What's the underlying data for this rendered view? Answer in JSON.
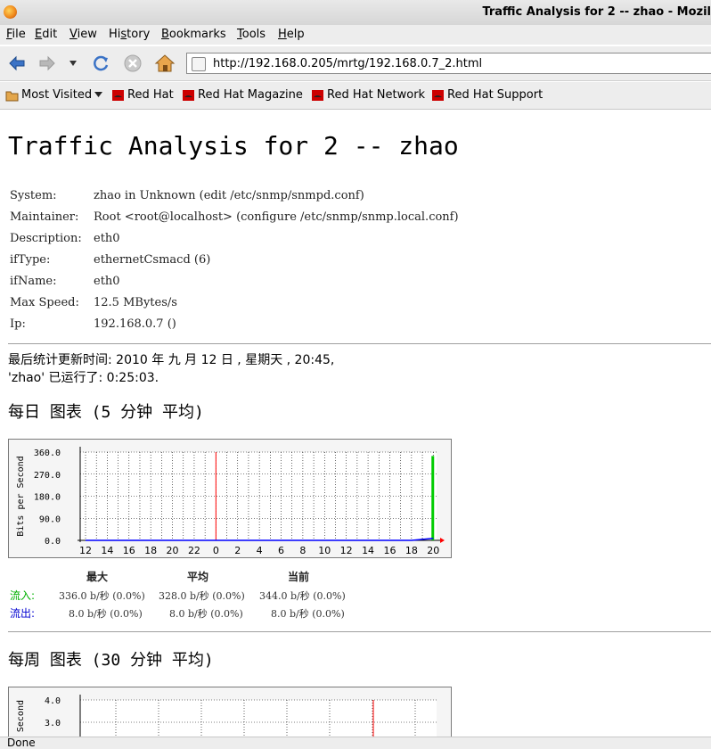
{
  "window": {
    "title": "Traffic Analysis for 2 -- zhao - Mozil"
  },
  "menu": [
    {
      "label": "File",
      "acc": "F",
      "rest": "ile"
    },
    {
      "label": "Edit",
      "acc": "E",
      "rest": "dit"
    },
    {
      "label": "View",
      "acc": "V",
      "rest": "iew"
    },
    {
      "label": "History",
      "pre": "Hi",
      "acc": "s",
      "rest": "tory"
    },
    {
      "label": "Bookmarks",
      "acc": "B",
      "rest": "ookmarks"
    },
    {
      "label": "Tools",
      "acc": "T",
      "rest": "ools"
    },
    {
      "label": "Help",
      "acc": "H",
      "rest": "elp"
    }
  ],
  "nav": {
    "back_icon": "back-arrow-icon",
    "forward_icon": "forward-arrow-icon",
    "history_dropdown_icon": "chevron-down-icon",
    "reload_icon": "reload-icon",
    "stop_icon": "stop-icon",
    "home_icon": "home-icon",
    "url": "http://192.168.0.205/mrtg/192.168.0.7_2.html"
  },
  "bookmarks": {
    "most_visited": "Most Visited",
    "items": [
      "Red Hat",
      "Red Hat Magazine",
      "Red Hat Network",
      "Red Hat Support"
    ]
  },
  "page": {
    "title": "Traffic Analysis for 2 -- zhao",
    "info": [
      {
        "key": "System:",
        "value": "zhao in Unknown (edit /etc/snmp/snmpd.conf)"
      },
      {
        "key": "Maintainer:",
        "value": "Root <root@localhost> (configure /etc/snmp/snmp.local.conf)"
      },
      {
        "key": "Description:",
        "value": "eth0"
      },
      {
        "key": "ifType:",
        "value": "ethernetCsmacd (6)"
      },
      {
        "key": "ifName:",
        "value": "eth0"
      },
      {
        "key": "Max Speed:",
        "value": "12.5 MBytes/s"
      },
      {
        "key": "Ip:",
        "value": "192.168.0.7 ()"
      }
    ],
    "last_update": "最后统计更新时间:  2010 年 九 月 12 日 , 星期天 ,  20:45,",
    "uptime": "'zhao' 已运行了:  0:25:03.",
    "daily": {
      "heading": "每日 图表 (5 分钟 平均)",
      "col_max": "最大",
      "col_avg": "平均",
      "col_cur": "当前",
      "in_label": "流入:",
      "out_label": "流出:",
      "in_max": "336.0 b/秒 (0.0%)",
      "in_avg": "328.0 b/秒 (0.0%)",
      "in_cur": "344.0 b/秒 (0.0%)",
      "out_max": "8.0 b/秒 (0.0%)",
      "out_avg": "8.0 b/秒 (0.0%)",
      "out_cur": "8.0 b/秒 (0.0%)"
    },
    "weekly": {
      "heading": "每周 图表 (30 分钟 平均)"
    }
  },
  "chart_data": [
    {
      "type": "area",
      "ylabel": "Bits per Second",
      "ylim": [
        0,
        360
      ],
      "yticks": [
        "360.0",
        "270.0",
        "180.0",
        "90.0",
        "0.0"
      ],
      "categories": [
        "12",
        "14",
        "16",
        "18",
        "20",
        "22",
        "0",
        "2",
        "4",
        "6",
        "8",
        "10",
        "12",
        "14",
        "16",
        "18",
        "20"
      ],
      "series": [
        {
          "name": "流入",
          "values": [
            0,
            0,
            0,
            0,
            0,
            0,
            0,
            0,
            0,
            0,
            0,
            0,
            0,
            0,
            0,
            0,
            344
          ]
        },
        {
          "name": "流出",
          "values": [
            0,
            0,
            0,
            0,
            0,
            0,
            0,
            0,
            0,
            0,
            0,
            0,
            0,
            0,
            0,
            0,
            8
          ]
        }
      ],
      "colors": {
        "in": "#00cc00",
        "out": "#0000ff",
        "midnight": "#ff0000",
        "grid": "#000000"
      },
      "grid": true
    },
    {
      "type": "area",
      "ylabel": "Second",
      "yticks": [
        "4.0",
        "3.0"
      ],
      "grid": true
    }
  ],
  "status": {
    "text": "Done"
  }
}
